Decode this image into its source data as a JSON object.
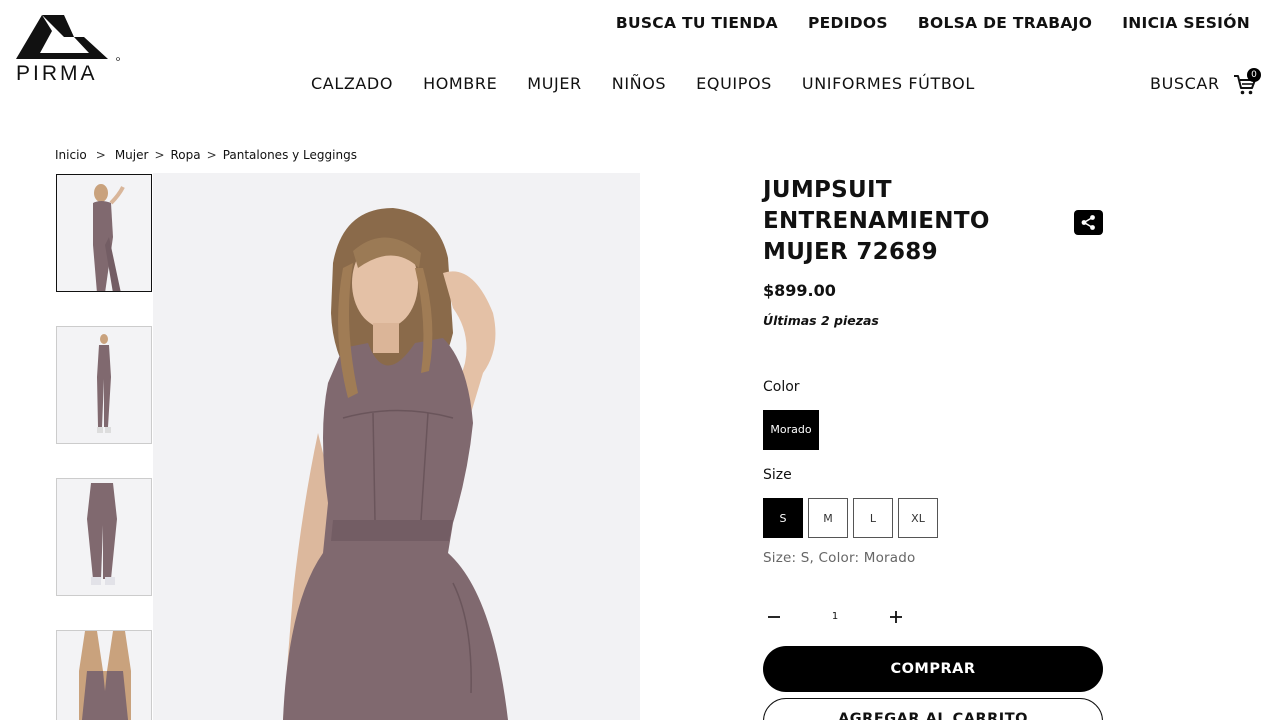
{
  "header": {
    "logo_text": "PIRMA",
    "top_links": [
      "BUSCA TU TIENDA",
      "PEDIDOS",
      "BOLSA DE TRABAJO",
      "INICIA SESIÓN"
    ],
    "nav": [
      "CALZADO",
      "HOMBRE",
      "MUJER",
      "NIÑOS",
      "EQUIPOS",
      "UNIFORMES FÚTBOL"
    ],
    "search_label": "BUSCAR",
    "cart_count": "0"
  },
  "breadcrumb": {
    "items": [
      "Inicio",
      "Mujer",
      "Ropa",
      "Pantalones y Leggings"
    ],
    "separator": ">"
  },
  "product": {
    "title": "JUMPSUIT ENTRENAMIENTO MUJER 72689",
    "price": "$899.00",
    "stock_note": "Últimas 2 piezas",
    "color_label": "Color",
    "color_options": [
      "Morado"
    ],
    "selected_color": "Morado",
    "size_label": "Size",
    "size_options": [
      "S",
      "M",
      "L",
      "XL"
    ],
    "selected_size": "S",
    "selection_summary": "Size: S, Color: Morado",
    "quantity": "1",
    "buy_label": "COMPRAR",
    "add_to_cart_label": "AGREGAR AL CARRITO"
  },
  "colors": {
    "garment": "#80696f",
    "accent": "#000000",
    "background": "#ffffff"
  },
  "icons": {
    "share": "share-icon",
    "cart": "cart-icon",
    "minus": "minus-icon",
    "plus": "plus-icon"
  }
}
